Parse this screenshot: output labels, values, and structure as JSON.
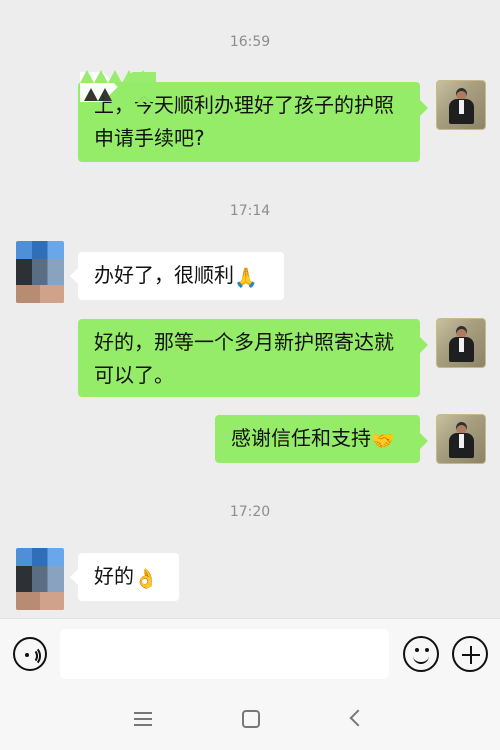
{
  "timestamps": [
    "16:59",
    "17:14",
    "17:20"
  ],
  "messages": [
    {
      "text": "上，今天顺利办理好了孩子的护照申请手续吧?"
    },
    {
      "text": "办好了，很顺利",
      "emoji": "🙏"
    },
    {
      "text": "好的，那等一个多月新护照寄达就可以了。"
    },
    {
      "text": "感谢信任和支持",
      "emoji": "🤝"
    },
    {
      "text": "好的",
      "emoji": "👌"
    }
  ],
  "input": {
    "value": "",
    "placeholder": ""
  },
  "icons": {
    "voice": "voice-icon",
    "emoji": "emoji-icon",
    "plus": "plus-icon",
    "menu": "menu-icon",
    "home": "home-icon",
    "back": "back-icon"
  },
  "colors": {
    "background": "#ededed",
    "my_bubble": "#95ec69",
    "their_bubble": "#ffffff",
    "timestamp": "#8d8d8d"
  }
}
